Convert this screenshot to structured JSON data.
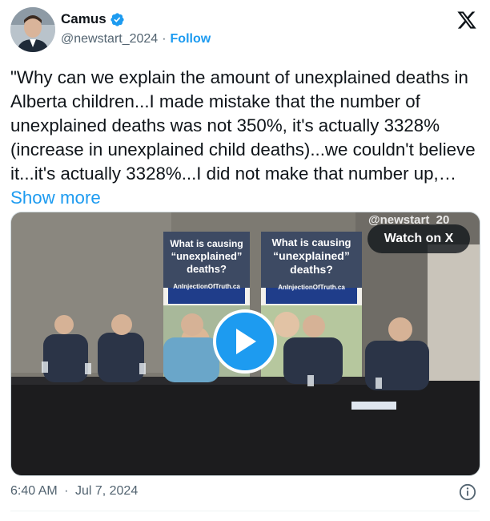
{
  "author": {
    "display_name": "Camus",
    "handle": "@newstart_2024",
    "separator": "·",
    "follow_label": "Follow",
    "verified_icon": "verified-badge-icon",
    "avatar_icon": "avatar"
  },
  "tweet": {
    "text": "\"Why can we explain the amount of unexplained deaths in Alberta children...I made mistake that the number of unexplained deaths was not 350%, it's actually 3328% (increase in unexplained child deaths)...we couldn't believe it...it's actually 3328%...I did not make that number up,…",
    "show_more_label": "Show more"
  },
  "media": {
    "watch_label": "Watch on X",
    "watermark": "@newstart_20",
    "banner_left": {
      "line1": "What is causing",
      "line2": "“unexplained”",
      "line3": "deaths?",
      "url": "AnInjectionOfTruth.ca"
    },
    "banner_right": {
      "line1": "What is causing",
      "line2": "“unexplained”",
      "line3": "deaths?",
      "url": "AnInjectionOfTruth.ca"
    }
  },
  "footer": {
    "time": "6:40 AM",
    "separator": "·",
    "date": "Jul 7, 2024"
  },
  "colors": {
    "accent": "#1d9bf0",
    "text": "#0f1419",
    "muted": "#536471"
  }
}
